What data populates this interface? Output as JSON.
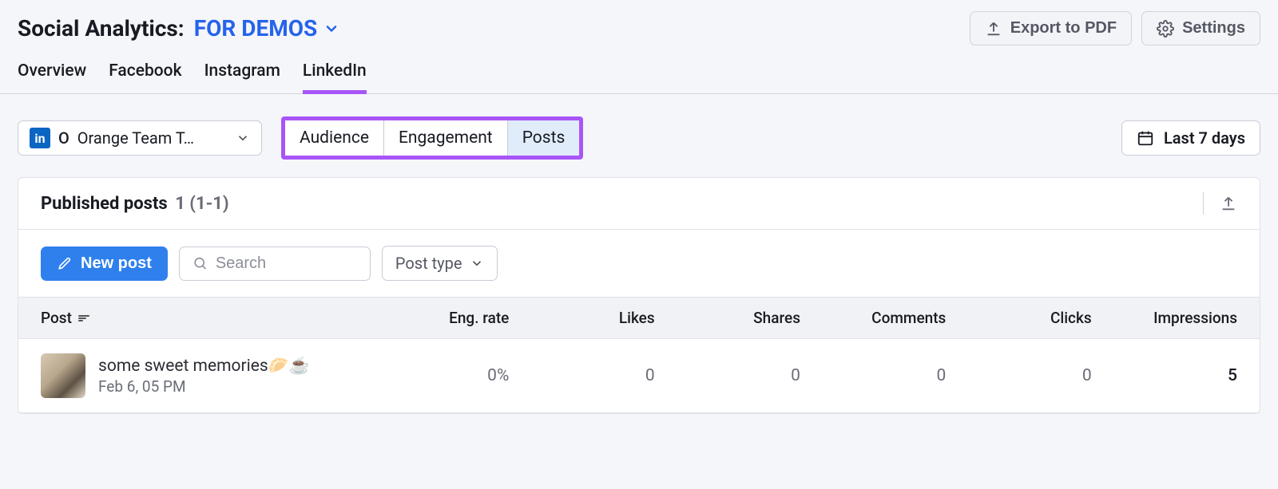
{
  "header": {
    "title": "Social Analytics:",
    "project": "FOR DEMOS",
    "export_label": "Export to PDF",
    "settings_label": "Settings"
  },
  "nav": {
    "tabs": [
      "Overview",
      "Facebook",
      "Instagram",
      "LinkedIn"
    ],
    "active": "LinkedIn"
  },
  "controls": {
    "account": {
      "platform_badge": "in",
      "avatar_letter": "O",
      "name": "Orange Team T…"
    },
    "segments": [
      "Audience",
      "Engagement",
      "Posts"
    ],
    "active_segment": "Posts",
    "date_range": "Last 7 days"
  },
  "panel": {
    "title": "Published posts",
    "count": "1 (1-1)",
    "new_post_label": "New post",
    "search_placeholder": "Search",
    "filter_label": "Post type"
  },
  "table": {
    "columns": [
      "Post",
      "Eng. rate",
      "Likes",
      "Shares",
      "Comments",
      "Clicks",
      "Impressions"
    ],
    "rows": [
      {
        "title": "some sweet memories🥟☕",
        "date": "Feb 6, 05 PM",
        "eng_rate": "0%",
        "likes": "0",
        "shares": "0",
        "comments": "0",
        "clicks": "0",
        "impressions": "5"
      }
    ]
  }
}
